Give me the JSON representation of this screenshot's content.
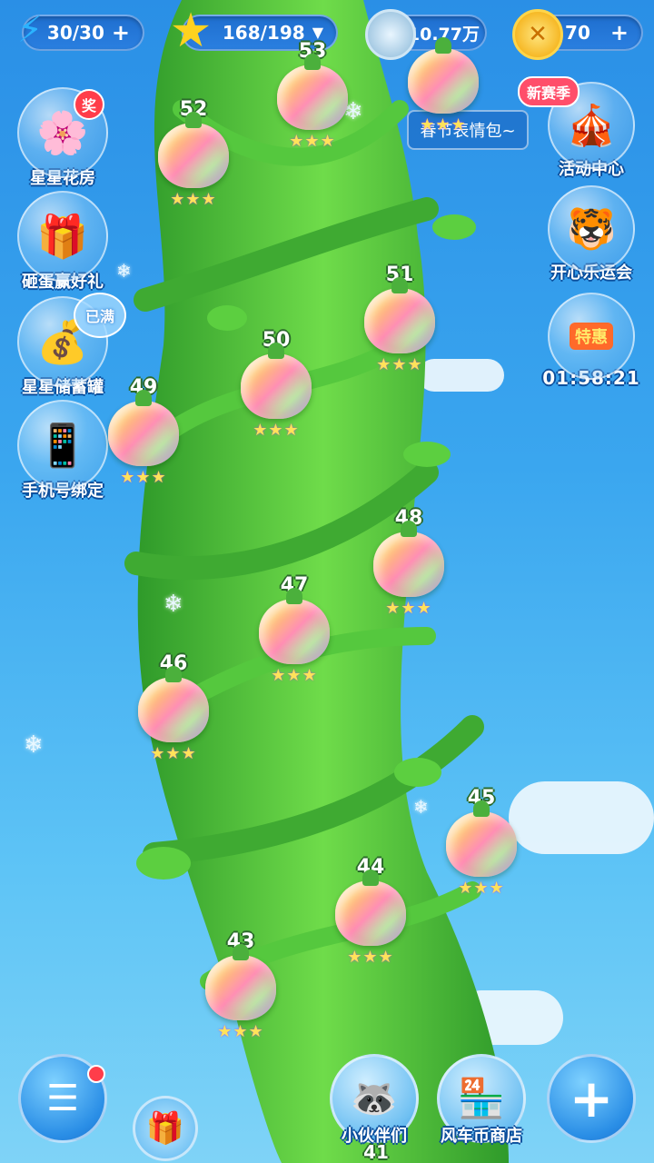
{
  "topbar": {
    "energy": "30/30",
    "stars": "168/198",
    "currency_value": "10.77万",
    "coins": "70"
  },
  "left_buttons": [
    {
      "label": "星星花房",
      "badge": "奖"
    },
    {
      "label": "砸蛋赢好礼"
    },
    {
      "label": "星星储蓄罐",
      "badge": "已满"
    },
    {
      "label": "手机号绑定"
    }
  ],
  "right_buttons": {
    "tooltip": "春节表情包~",
    "new_season_badge": "新赛季",
    "activity_center": "活动中心",
    "games": "开心乐运会",
    "special_offer": "特惠",
    "timer": "01:58:21"
  },
  "levels": [
    {
      "num": "53",
      "stars": "★★★"
    },
    {
      "num": "52",
      "stars": "★★★"
    },
    {
      "num": "51",
      "stars": "★★★"
    },
    {
      "num": "50",
      "stars": "★★★"
    },
    {
      "num": "49",
      "stars": "★★★"
    },
    {
      "num": "48",
      "stars": "★★★"
    },
    {
      "num": "47",
      "stars": "★★★"
    },
    {
      "num": "46",
      "stars": "★★★"
    },
    {
      "num": "45",
      "stars": "★★★"
    },
    {
      "num": "44",
      "stars": "★★★"
    },
    {
      "num": "43",
      "stars": "★★★"
    },
    {
      "num": "41",
      "stars": ""
    }
  ],
  "bottom": {
    "partners": "小伙伴们",
    "shop": "风车币商店"
  },
  "colors": {
    "sky": "#3aa6ef",
    "stalk": "#4cc23a",
    "badge_red": "#ff3d4a"
  }
}
